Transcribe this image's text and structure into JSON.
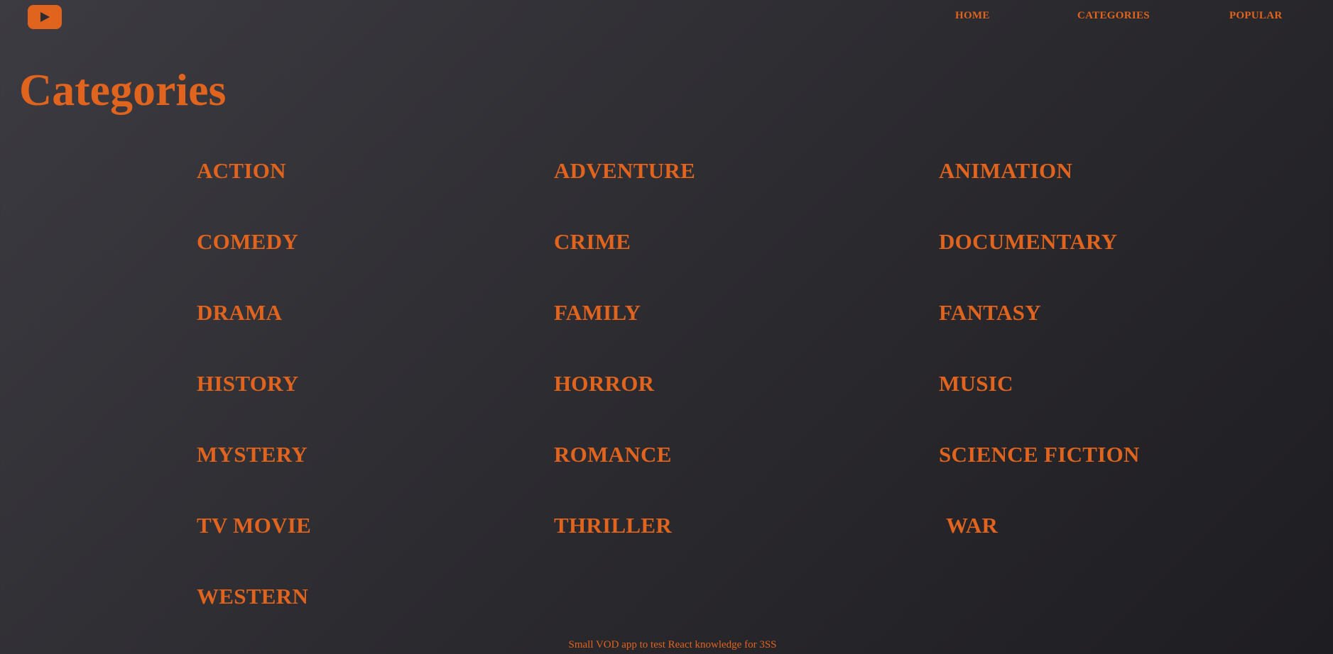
{
  "brand": {
    "logo_icon": "play-button-icon",
    "accent_color": "#e0641e"
  },
  "nav": {
    "items": [
      {
        "label": "HOME"
      },
      {
        "label": "CATEGORIES"
      },
      {
        "label": "POPULAR"
      }
    ]
  },
  "page": {
    "title": "Categories"
  },
  "categories": [
    "ACTION",
    "ADVENTURE",
    "ANIMATION",
    "COMEDY",
    "CRIME",
    "DOCUMENTARY",
    "DRAMA",
    "FAMILY",
    "FANTASY",
    "HISTORY",
    "HORROR",
    "MUSIC",
    "MYSTERY",
    "ROMANCE",
    "SCIENCE FICTION",
    "TV MOVIE",
    "THRILLER",
    "WAR",
    "WESTERN"
  ],
  "footer": {
    "text": "Small VOD app to test React knowledge for 3SS"
  }
}
